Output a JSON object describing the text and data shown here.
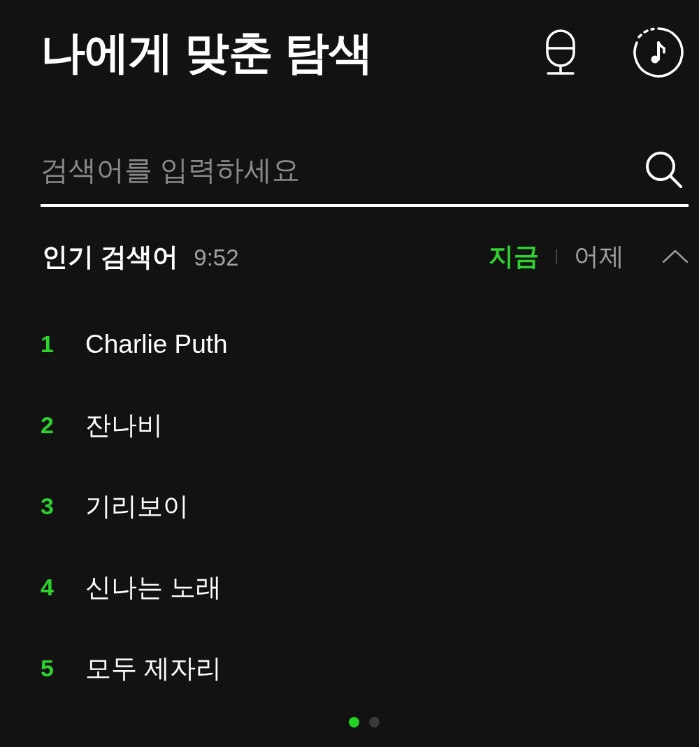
{
  "header": {
    "title": "나에게 맞춘 탐색"
  },
  "search": {
    "placeholder": "검색어를 입력하세요"
  },
  "popular": {
    "title": "인기 검색어",
    "time": "9:52",
    "tabs": [
      {
        "label": "지금",
        "selected": true
      },
      {
        "label": "어제",
        "selected": false
      }
    ],
    "expanded": true,
    "items": [
      {
        "rank": "1",
        "text": "Charlie Puth"
      },
      {
        "rank": "2",
        "text": "잔나비"
      },
      {
        "rank": "3",
        "text": "기리보이"
      },
      {
        "rank": "4",
        "text": "신나는 노래"
      },
      {
        "rank": "5",
        "text": "모두 제자리"
      }
    ]
  },
  "pager": [
    {
      "selected": true
    },
    {
      "selected": false
    }
  ]
}
